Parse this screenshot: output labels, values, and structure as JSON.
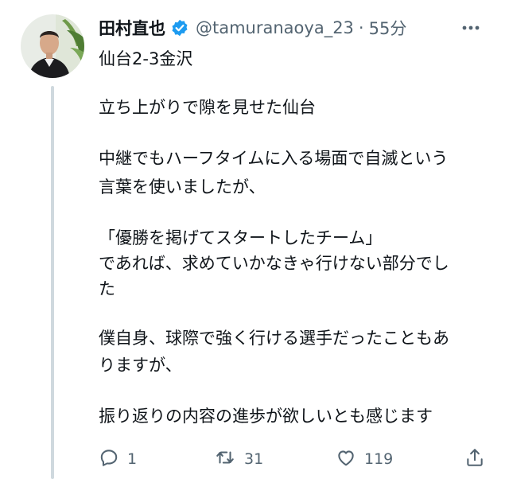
{
  "tweet": {
    "display_name": "田村直也",
    "verified_badge": "verified-badge-icon",
    "handle": "@tamuranaoya_23",
    "separator": "·",
    "time": "55分",
    "subline": "仙台2-3金沢",
    "lines": [
      "立ち上がりで隙を見せた仙台",
      "中継でもハーフタイムに入る場面で自滅という",
      "言葉を使いましたが、",
      "「優勝を掲げてスタートしたチーム」",
      "であれば、求めていかなきゃ行けない部分でし",
      "た",
      "僕自身、球際で強く行ける選手だったこともあ",
      "りますが、",
      "振り返りの内容の進歩が欲しいとも感じます"
    ]
  },
  "actions": {
    "reply_count": "1",
    "retweet_count": "31",
    "like_count": "119",
    "icons": [
      "reply-icon",
      "retweet-icon",
      "like-icon",
      "share-icon"
    ]
  },
  "colors": {
    "text": "#0f1419",
    "secondary": "#536471",
    "verified": "#1d9bf0",
    "thread_line": "#cfd9de"
  }
}
